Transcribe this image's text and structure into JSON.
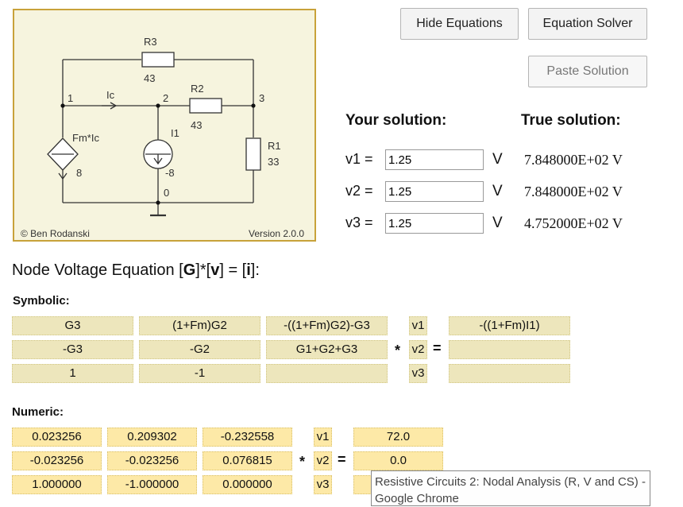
{
  "circuit": {
    "R3": "R3",
    "R3_val": "43",
    "R2": "R2",
    "R2_val": "43",
    "R1": "R1",
    "R1_val": "33",
    "I1": "I1",
    "I1_val": "-8",
    "dep": "Fm*Ic",
    "dep_val": "8",
    "Ic": "Ic",
    "node1": "1",
    "node2": "2",
    "node3": "3",
    "node0": "0",
    "copyright": "© Ben Rodanski",
    "version": "Version 2.0.0"
  },
  "buttons": {
    "hide_equations": "Hide Equations",
    "equation_solver": "Equation Solver",
    "paste_solution": "Paste Solution"
  },
  "solution": {
    "your_heading": "Your solution:",
    "true_heading": "True solution:",
    "rows": [
      {
        "label": "v1 =",
        "value": "1.25",
        "unit": "V",
        "true": "7.848000E+02 V"
      },
      {
        "label": "v2 =",
        "value": "1.25",
        "unit": "V",
        "true": "7.848000E+02 V"
      },
      {
        "label": "v3 =",
        "value": "1.25",
        "unit": "V",
        "true": "4.752000E+02 V"
      }
    ]
  },
  "equation": {
    "title_a": "Node Voltage Equation [",
    "title_G": "G",
    "title_b": "]*[",
    "title_v": "v",
    "title_c": "] = [",
    "title_i": "i",
    "title_d": "]:",
    "symbolic_label": "Symbolic:",
    "numeric_label": "Numeric:",
    "star": "*",
    "equals": "=",
    "symbolic": [
      [
        "G3",
        "(1+Fm)G2",
        "-((1+Fm)G2)-G3",
        "v1",
        "-((1+Fm)I1)"
      ],
      [
        "-G3",
        "-G2",
        "G1+G2+G3",
        "v2",
        ""
      ],
      [
        "1",
        "-1",
        "",
        "v3",
        ""
      ]
    ],
    "numeric": [
      [
        "0.023256",
        "0.209302",
        "-0.232558",
        "v1",
        "72.0"
      ],
      [
        "-0.023256",
        "-0.023256",
        "0.076815",
        "v2",
        "0.0"
      ],
      [
        "1.000000",
        "-1.000000",
        "0.000000",
        "v3",
        ""
      ]
    ]
  },
  "tooltip": "Resistive Circuits 2: Nodal Analysis (R, V and CS) - Google Chrome"
}
